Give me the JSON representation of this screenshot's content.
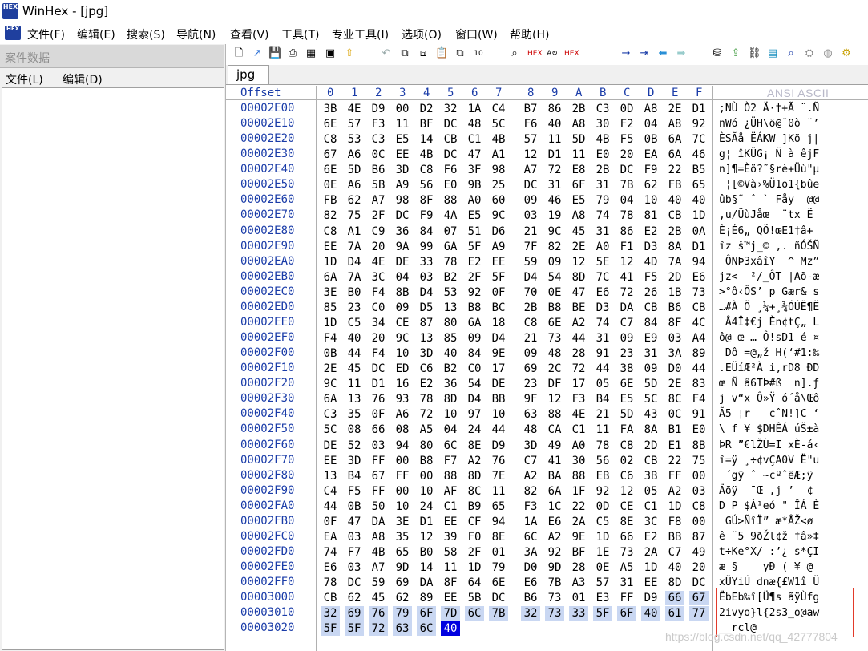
{
  "title": "WinHex - [jpg]",
  "app_icon_text": "HEX",
  "menu": [
    "文件(F)",
    "编辑(E)",
    "搜索(S)",
    "导航(N)",
    "查看(V)",
    "工具(T)",
    "专业工具(I)",
    "选项(O)",
    "窗口(W)",
    "帮助(H)"
  ],
  "left_pane": {
    "title": "案件数据",
    "menu": [
      "文件(L)",
      "编辑(D)"
    ]
  },
  "toolbar_icons": [
    "new-file-icon",
    "open-icon",
    "save-icon",
    "print-icon",
    "properties-icon",
    "export-icon",
    "undo-icon",
    "copy-icon",
    "cut-icon",
    "paste-icon",
    "copy-block-icon",
    "paste-hex-icon",
    "find-icon",
    "find-hex-icon",
    "replace-icon",
    "replace-hex-icon",
    "goto-offset-icon",
    "goto-page-icon",
    "back-icon",
    "forward-icon",
    "disk-icon",
    "ram-icon",
    "network-icon",
    "calculator-icon",
    "search-disk-icon",
    "hash-icon",
    "settings-icon"
  ],
  "tab": "jpg",
  "hex": {
    "offset_header": "Offset",
    "columns": [
      "0",
      "1",
      "2",
      "3",
      "4",
      "5",
      "6",
      "7",
      "8",
      "9",
      "A",
      "B",
      "C",
      "D",
      "E",
      "F"
    ],
    "ansi_header": "ANSI ASCII",
    "rows": [
      {
        "offset": "00002E00",
        "bytes": [
          "3B",
          "4E",
          "D9",
          "00",
          "D2",
          "32",
          "1A",
          "C4",
          "B7",
          "86",
          "2B",
          "C3",
          "0D",
          "A8",
          "2E",
          "D1"
        ],
        "ascii": ";NÙ Ò2 Ä·†+Ã ¨.Ñ"
      },
      {
        "offset": "00002E10",
        "bytes": [
          "6E",
          "57",
          "F3",
          "11",
          "BF",
          "DC",
          "48",
          "5C",
          "F6",
          "40",
          "A8",
          "30",
          "F2",
          "04",
          "A8",
          "92"
        ],
        "ascii": "nWó ¿ÜH\\ö@¨0ò ¨’"
      },
      {
        "offset": "00002E20",
        "bytes": [
          "C8",
          "53",
          "C3",
          "E5",
          "14",
          "CB",
          "C1",
          "4B",
          "57",
          "11",
          "5D",
          "4B",
          "F5",
          "0B",
          "6A",
          "7C"
        ],
        "ascii": "ÈSÃå ËÁKW ]Kõ j|"
      },
      {
        "offset": "00002E30",
        "bytes": [
          "67",
          "A6",
          "0C",
          "EE",
          "4B",
          "DC",
          "47",
          "A1",
          "12",
          "D1",
          "11",
          "E0",
          "20",
          "EA",
          "6A",
          "46"
        ],
        "ascii": "g¦ îKÜG¡ Ñ à êjF"
      },
      {
        "offset": "00002E40",
        "bytes": [
          "6E",
          "5D",
          "B6",
          "3D",
          "C8",
          "F6",
          "3F",
          "98",
          "A7",
          "72",
          "E8",
          "2B",
          "DC",
          "F9",
          "22",
          "B5"
        ],
        "ascii": "n]¶=Èö?˜§rè+Üù\"µ"
      },
      {
        "offset": "00002E50",
        "bytes": [
          "0E",
          "A6",
          "5B",
          "A9",
          "56",
          "E0",
          "9B",
          "25",
          "DC",
          "31",
          "6F",
          "31",
          "7B",
          "62",
          "FB",
          "65"
        ],
        "ascii": " ¦[©Và›%Ü1o1{bûe"
      },
      {
        "offset": "00002E60",
        "bytes": [
          "FB",
          "62",
          "A7",
          "98",
          "8F",
          "88",
          "A0",
          "60",
          "09",
          "46",
          "E5",
          "79",
          "04",
          "10",
          "40",
          "40"
        ],
        "ascii": "ûb§˜ ˆ ` Fåy  @@"
      },
      {
        "offset": "00002E70",
        "bytes": [
          "82",
          "75",
          "2F",
          "DC",
          "F9",
          "4A",
          "E5",
          "9C",
          "03",
          "19",
          "A8",
          "74",
          "78",
          "81",
          "CB",
          "1D"
        ],
        "ascii": ",u/ÜùJåœ  ¨tx Ë "
      },
      {
        "offset": "00002E80",
        "bytes": [
          "C8",
          "A1",
          "C9",
          "36",
          "84",
          "07",
          "51",
          "D6",
          "21",
          "9C",
          "45",
          "31",
          "86",
          "E2",
          "2B",
          "0A"
        ],
        "ascii": "È¡É6„ QÖ!œE1†â+ "
      },
      {
        "offset": "00002E90",
        "bytes": [
          "EE",
          "7A",
          "20",
          "9A",
          "99",
          "6A",
          "5F",
          "A9",
          "7F",
          "82",
          "2E",
          "A0",
          "F1",
          "D3",
          "8A",
          "D1"
        ],
        "ascii": "îz š™j_© ,. ñÓŠÑ"
      },
      {
        "offset": "00002EA0",
        "bytes": [
          "1D",
          "D4",
          "4E",
          "DE",
          "33",
          "78",
          "E2",
          "EE",
          "59",
          "09",
          "12",
          "5E",
          "12",
          "4D",
          "7A",
          "94"
        ],
        "ascii": " ÔNÞ3xâîY  ^ Mz”"
      },
      {
        "offset": "00002EB0",
        "bytes": [
          "6A",
          "7A",
          "3C",
          "04",
          "03",
          "B2",
          "2F",
          "5F",
          "D4",
          "54",
          "8D",
          "7C",
          "41",
          "F5",
          "2D",
          "E6"
        ],
        "ascii": "jz<  ²/_ÔT |Aõ-æ"
      },
      {
        "offset": "00002EC0",
        "bytes": [
          "3E",
          "B0",
          "F4",
          "8B",
          "D4",
          "53",
          "92",
          "0F",
          "70",
          "0E",
          "47",
          "E6",
          "72",
          "26",
          "1B",
          "73"
        ],
        "ascii": ">°ô‹ÔS’ p Gær& s"
      },
      {
        "offset": "00002ED0",
        "bytes": [
          "85",
          "23",
          "C0",
          "09",
          "D5",
          "13",
          "B8",
          "BC",
          "2B",
          "B8",
          "BE",
          "D3",
          "DA",
          "CB",
          "B6",
          "CB"
        ],
        "ascii": "…#À Õ ¸¼+¸¾ÓÚË¶Ë"
      },
      {
        "offset": "00002EE0",
        "bytes": [
          "1D",
          "C5",
          "34",
          "CE",
          "87",
          "80",
          "6A",
          "18",
          "C8",
          "6E",
          "A2",
          "74",
          "C7",
          "84",
          "8F",
          "4C"
        ],
        "ascii": " Å4Î‡€j Èn¢tÇ„ L"
      },
      {
        "offset": "00002EF0",
        "bytes": [
          "F4",
          "40",
          "20",
          "9C",
          "13",
          "85",
          "09",
          "D4",
          "21",
          "73",
          "44",
          "31",
          "09",
          "E9",
          "03",
          "A4"
        ],
        "ascii": "ô@ œ … Ô!sD1 é ¤"
      },
      {
        "offset": "00002F00",
        "bytes": [
          "0B",
          "44",
          "F4",
          "10",
          "3D",
          "40",
          "84",
          "9E",
          "09",
          "48",
          "28",
          "91",
          "23",
          "31",
          "3A",
          "89"
        ],
        "ascii": " Dô =@„ž H(‘#1:‰"
      },
      {
        "offset": "00002F10",
        "bytes": [
          "2E",
          "45",
          "DC",
          "ED",
          "C6",
          "B2",
          "C0",
          "17",
          "69",
          "2C",
          "72",
          "44",
          "38",
          "09",
          "D0",
          "44"
        ],
        "ascii": ".EÜíÆ²À i,rD8 ÐD"
      },
      {
        "offset": "00002F20",
        "bytes": [
          "9C",
          "11",
          "D1",
          "16",
          "E2",
          "36",
          "54",
          "DE",
          "23",
          "DF",
          "17",
          "05",
          "6E",
          "5D",
          "2E",
          "83"
        ],
        "ascii": "œ Ñ â6TÞ#ß  n].ƒ"
      },
      {
        "offset": "00002F30",
        "bytes": [
          "6A",
          "13",
          "76",
          "93",
          "78",
          "8D",
          "D4",
          "BB",
          "9F",
          "12",
          "F3",
          "B4",
          "E5",
          "5C",
          "8C",
          "F4"
        ],
        "ascii": "j v“x Ô»Ÿ ó´å\\Œô"
      },
      {
        "offset": "00002F40",
        "bytes": [
          "C3",
          "35",
          "0F",
          "A6",
          "72",
          "10",
          "97",
          "10",
          "63",
          "88",
          "4E",
          "21",
          "5D",
          "43",
          "0C",
          "91"
        ],
        "ascii": "Ã5 ¦r — cˆN!]C ‘"
      },
      {
        "offset": "00002F50",
        "bytes": [
          "5C",
          "08",
          "66",
          "08",
          "A5",
          "04",
          "24",
          "44",
          "48",
          "CA",
          "C1",
          "11",
          "FA",
          "8A",
          "B1",
          "E0"
        ],
        "ascii": "\\ f ¥ $DHÊÁ úŠ±à"
      },
      {
        "offset": "00002F60",
        "bytes": [
          "DE",
          "52",
          "03",
          "94",
          "80",
          "6C",
          "8E",
          "D9",
          "3D",
          "49",
          "A0",
          "78",
          "C8",
          "2D",
          "E1",
          "8B"
        ],
        "ascii": "ÞR ”€lŽÙ=I xÈ-á‹"
      },
      {
        "offset": "00002F70",
        "bytes": [
          "EE",
          "3D",
          "FF",
          "00",
          "B8",
          "F7",
          "A2",
          "76",
          "C7",
          "41",
          "30",
          "56",
          "02",
          "CB",
          "22",
          "75"
        ],
        "ascii": "î=ÿ ¸÷¢vÇA0V Ë\"u"
      },
      {
        "offset": "00002F80",
        "bytes": [
          "13",
          "B4",
          "67",
          "FF",
          "00",
          "88",
          "8D",
          "7E",
          "A2",
          "BA",
          "88",
          "EB",
          "C6",
          "3B",
          "FF",
          "00"
        ],
        "ascii": " ´gÿ ˆ ~¢ºˆëÆ;ÿ "
      },
      {
        "offset": "00002F90",
        "bytes": [
          "C4",
          "F5",
          "FF",
          "00",
          "10",
          "AF",
          "8C",
          "11",
          "82",
          "6A",
          "1F",
          "92",
          "12",
          "05",
          "A2",
          "03"
        ],
        "ascii": "Äõÿ  ¯Œ ‚j ’  ¢ "
      },
      {
        "offset": "00002FA0",
        "bytes": [
          "44",
          "0B",
          "50",
          "10",
          "24",
          "C1",
          "B9",
          "65",
          "F3",
          "1C",
          "22",
          "0D",
          "CE",
          "C1",
          "1D",
          "C8"
        ],
        "ascii": "D P $Á¹eó \" ÎÁ È"
      },
      {
        "offset": "00002FB0",
        "bytes": [
          "0F",
          "47",
          "DA",
          "3E",
          "D1",
          "EE",
          "CF",
          "94",
          "1A",
          "E6",
          "2A",
          "C5",
          "8E",
          "3C",
          "F8",
          "00"
        ],
        "ascii": " GÚ>ÑîÏ” æ*ÅŽ<ø "
      },
      {
        "offset": "00002FC0",
        "bytes": [
          "EA",
          "03",
          "A8",
          "35",
          "12",
          "39",
          "F0",
          "8E",
          "6C",
          "A2",
          "9E",
          "1D",
          "66",
          "E2",
          "BB",
          "87"
        ],
        "ascii": "ê ¨5 9ðŽl¢ž fâ»‡"
      },
      {
        "offset": "00002FD0",
        "bytes": [
          "74",
          "F7",
          "4B",
          "65",
          "B0",
          "58",
          "2F",
          "01",
          "3A",
          "92",
          "BF",
          "1E",
          "73",
          "2A",
          "C7",
          "49"
        ],
        "ascii": "t÷Ke°X/ :’¿ s*ÇI"
      },
      {
        "offset": "00002FE0",
        "bytes": [
          "E6",
          "03",
          "A7",
          "9D",
          "14",
          "11",
          "1D",
          "79",
          "D0",
          "9D",
          "28",
          "0E",
          "A5",
          "1D",
          "40",
          "20"
        ],
        "ascii": "æ §    yÐ ( ¥ @ "
      },
      {
        "offset": "00002FF0",
        "bytes": [
          "78",
          "DC",
          "59",
          "69",
          "DA",
          "8F",
          "64",
          "6E",
          "E6",
          "7B",
          "A3",
          "57",
          "31",
          "EE",
          "8D",
          "DC"
        ],
        "ascii": "xÜYiÚ dnæ{£W1î Ü"
      },
      {
        "offset": "00003000",
        "bytes": [
          "CB",
          "62",
          "45",
          "62",
          "89",
          "EE",
          "5B",
          "DC",
          "B6",
          "73",
          "01",
          "E3",
          "FF",
          "D9",
          "66",
          "67"
        ],
        "ascii": "ËbEb‰î[Ü¶s ãÿÙfg",
        "sel_from": 14
      },
      {
        "offset": "00003010",
        "bytes": [
          "32",
          "69",
          "76",
          "79",
          "6F",
          "7D",
          "6C",
          "7B",
          "32",
          "73",
          "33",
          "5F",
          "6F",
          "40",
          "61",
          "77"
        ],
        "ascii": "2ivyo}l{2s3_o@aw",
        "sel_from": 0
      },
      {
        "offset": "00003020",
        "bytes": [
          "5F",
          "5F",
          "72",
          "63",
          "6C",
          "40"
        ],
        "ascii": "__rcl@",
        "sel_from": 0,
        "cursor": 5
      }
    ]
  },
  "watermark": "https://blog.csdn.net/qq_42777804"
}
